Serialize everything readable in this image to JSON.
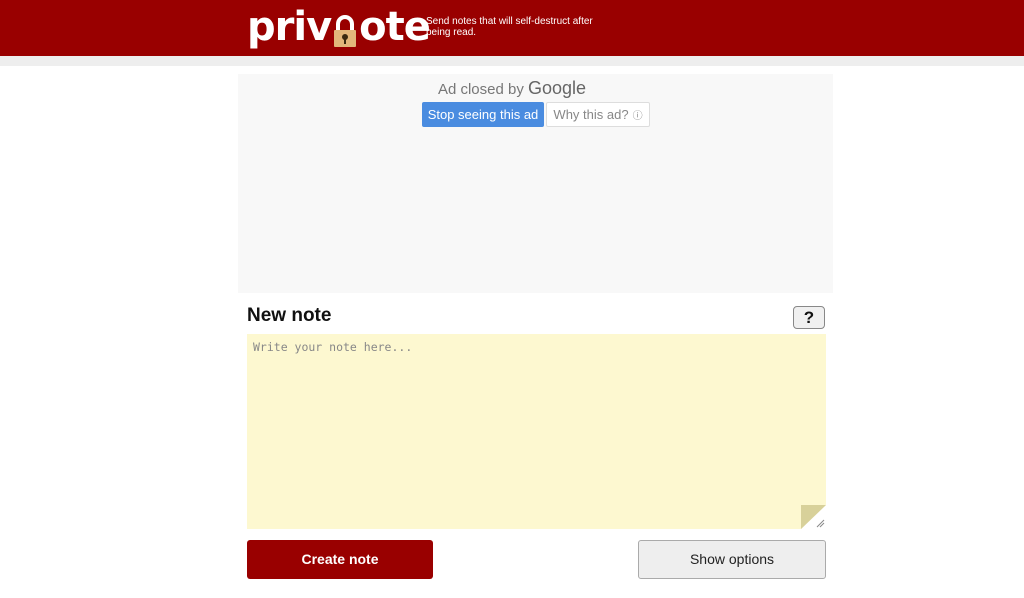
{
  "header": {
    "logo_left": "priv",
    "logo_right": "ote",
    "tagline": "Send notes that will self-destruct after being read."
  },
  "ad": {
    "closed_by": "Ad closed by",
    "closed_by_brand": "Google",
    "stop_label": "Stop seeing this ad",
    "why_label": "Why this ad?",
    "why_icon": "ⓘ"
  },
  "editor": {
    "title": "New note",
    "help_label": "?",
    "note_value": "",
    "note_placeholder": "Write your note here..."
  },
  "actions": {
    "create_label": "Create note",
    "options_label": "Show options"
  },
  "colors": {
    "brand": "#990000",
    "note_bg": "#fdf8d0",
    "ad_button": "#4a8ce0"
  }
}
